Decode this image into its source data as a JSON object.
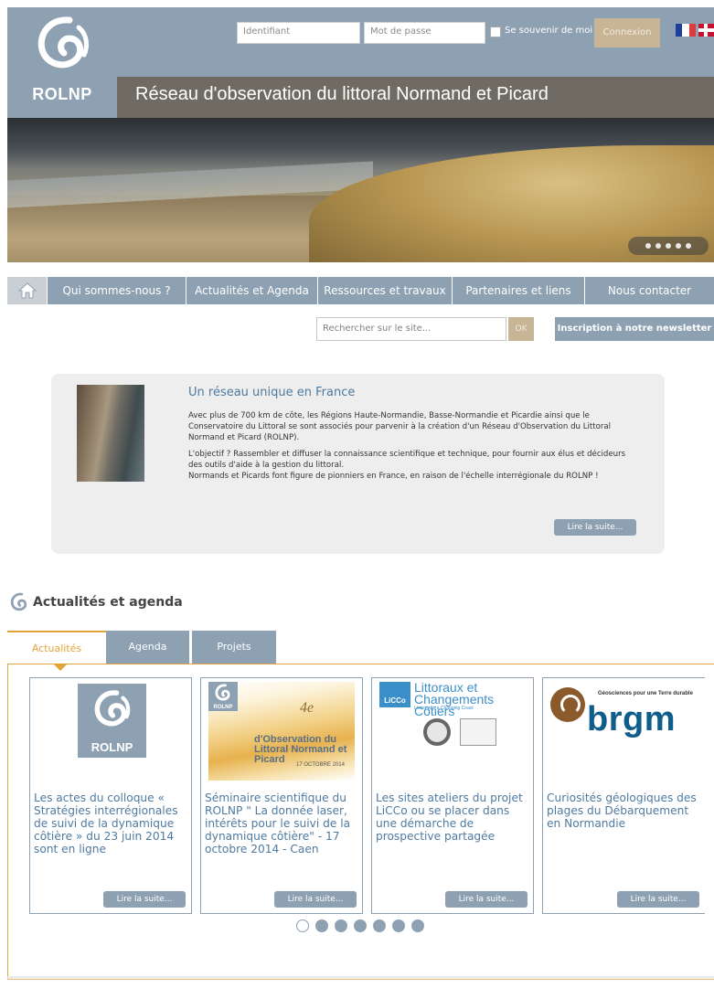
{
  "header": {
    "logo_text": "ROLNP",
    "title": "Réseau d'observation du littoral Normand et Picard",
    "login": {
      "user_placeholder": "Identifiant",
      "pass_placeholder": "Mot de passe",
      "remember_label": "Se souvenir de moi",
      "submit_label": "Connexion"
    },
    "languages": [
      "fr",
      "en"
    ]
  },
  "hero": {
    "slides": 5,
    "current_slide": 1
  },
  "nav": {
    "home_icon": "home-icon",
    "items": [
      {
        "label": "Qui sommes-nous ?"
      },
      {
        "label": "Actualités et Agenda"
      },
      {
        "label": "Ressources et travaux"
      },
      {
        "label": "Partenaires et liens"
      },
      {
        "label": "Nous contacter"
      }
    ]
  },
  "search": {
    "placeholder": "Rechercher sur le site...",
    "submit_label": "OK",
    "newsletter_label": "Inscription à notre newsletter !"
  },
  "intro": {
    "title": "Un réseau unique en France",
    "paragraphs": [
      "Avec plus de 700 km de côte, les Régions Haute-Normandie, Basse-Normandie et Picardie ainsi que le Conservatoire du Littoral se sont associés pour parvenir à la création d'un Réseau d'Observation du Littoral Normand et Picard (ROLNP).",
      "L'objectif ? Rassembler et diffuser la connaissance scientifique et technique, pour fournir aux élus et décideurs des outils d'aide à la gestion du littoral.",
      "Normands et Picards font figure de pionniers en France, en raison de l'échelle interrégionale du ROLNP !"
    ],
    "more_label": "Lire la suite..."
  },
  "news": {
    "section_title": "Actualités et agenda",
    "tabs": [
      {
        "label": "Actualités",
        "active": true
      },
      {
        "label": "Agenda",
        "active": false
      },
      {
        "label": "Projets",
        "active": false
      }
    ],
    "cards": [
      {
        "image_logo_text": "ROLNP",
        "text": "Les actes du colloque « Stratégies interrégionales de suivi de la dynamique côtière » du 23 juin 2014 sont en ligne",
        "more_label": "Lire la suite..."
      },
      {
        "image_logo_text": "ROLNP",
        "image_big": "4e",
        "image_title": "d'Observation du Littoral Normand et Picard",
        "image_date": "17 OCTOBRE 2014",
        "text": "Séminaire scientifique du ROLNP \" La donnée laser, intérêts pour le suivi de la dynamique côtière\" - 17 octobre 2014 - Caen",
        "more_label": "Lire la suite..."
      },
      {
        "image_logo_text": "LiCCo",
        "image_title": "Littoraux et Changements Côtiers",
        "image_subtitle": "Living with a Changing Coast",
        "text": "Les sites ateliers du projet LiCCo ou se placer dans une démarche de prospective partagée",
        "more_label": "Lire la suite..."
      },
      {
        "image_tagline": "Géosciences pour une Terre durable",
        "image_word": "brgm",
        "text": "Curiosités géologiques des plages du Débarquement en Normandie",
        "more_label": "Lire la suite..."
      }
    ],
    "pager": {
      "pages": 7,
      "current": 1
    }
  },
  "colors": {
    "accent_blue": "#8ea1b3",
    "accent_gold": "#e2a33a",
    "text_link": "#4f7aa0",
    "button_tan": "#c7b595"
  }
}
